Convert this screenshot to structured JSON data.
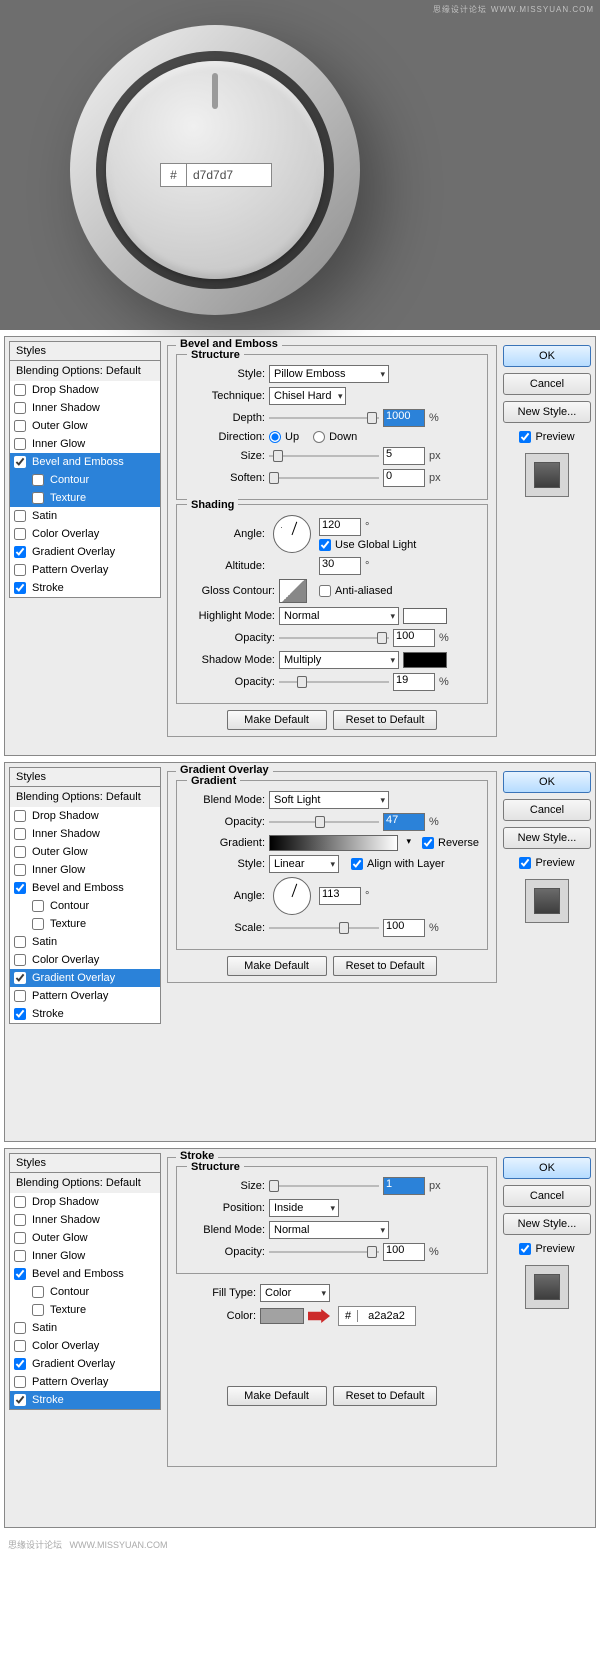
{
  "watermark": {
    "cn": "思缘设计论坛",
    "url": "WWW.MISSYUAN.COM"
  },
  "knob": {
    "hash": "#",
    "hex": "d7d7d7"
  },
  "styles": {
    "header": "Styles",
    "blending": "Blending Options: Default",
    "items": [
      {
        "label": "Drop Shadow",
        "checked": false,
        "indent": false
      },
      {
        "label": "Inner Shadow",
        "checked": false,
        "indent": false
      },
      {
        "label": "Outer Glow",
        "checked": false,
        "indent": false
      },
      {
        "label": "Inner Glow",
        "checked": false,
        "indent": false
      },
      {
        "label": "Bevel and Emboss",
        "checked": true,
        "indent": false
      },
      {
        "label": "Contour",
        "checked": false,
        "indent": true
      },
      {
        "label": "Texture",
        "checked": false,
        "indent": true
      },
      {
        "label": "Satin",
        "checked": false,
        "indent": false
      },
      {
        "label": "Color Overlay",
        "checked": false,
        "indent": false
      },
      {
        "label": "Gradient Overlay",
        "checked": true,
        "indent": false
      },
      {
        "label": "Pattern Overlay",
        "checked": false,
        "indent": false
      },
      {
        "label": "Stroke",
        "checked": true,
        "indent": false
      }
    ]
  },
  "panel1": {
    "selected": "Bevel and Emboss",
    "title": "Bevel and Emboss",
    "structure": {
      "legend": "Structure",
      "style_lbl": "Style:",
      "style_val": "Pillow Emboss",
      "tech_lbl": "Technique:",
      "tech_val": "Chisel Hard",
      "depth_lbl": "Depth:",
      "depth_val": "1000",
      "depth_unit": "%",
      "dir_lbl": "Direction:",
      "up": "Up",
      "down": "Down",
      "size_lbl": "Size:",
      "size_val": "5",
      "size_unit": "px",
      "soften_lbl": "Soften:",
      "soften_val": "0",
      "soften_unit": "px"
    },
    "shading": {
      "legend": "Shading",
      "angle_lbl": "Angle:",
      "angle_val": "120",
      "angle_unit": "°",
      "global": "Use Global Light",
      "alt_lbl": "Altitude:",
      "alt_val": "30",
      "alt_unit": "°",
      "gloss_lbl": "Gloss Contour:",
      "anti": "Anti-aliased",
      "hlmode_lbl": "Highlight Mode:",
      "hlmode_val": "Normal",
      "hlop_lbl": "Opacity:",
      "hlop_val": "100",
      "hlop_unit": "%",
      "shmode_lbl": "Shadow Mode:",
      "shmode_val": "Multiply",
      "shop_lbl": "Opacity:",
      "shop_val": "19",
      "shop_unit": "%"
    }
  },
  "panel2": {
    "selected": "Gradient Overlay",
    "title": "Gradient Overlay",
    "legend": "Gradient",
    "blend_lbl": "Blend Mode:",
    "blend_val": "Soft Light",
    "op_lbl": "Opacity:",
    "op_val": "47",
    "op_unit": "%",
    "grad_lbl": "Gradient:",
    "reverse": "Reverse",
    "style_lbl": "Style:",
    "style_val": "Linear",
    "align": "Align with Layer",
    "angle_lbl": "Angle:",
    "angle_val": "113",
    "angle_unit": "°",
    "scale_lbl": "Scale:",
    "scale_val": "100",
    "scale_unit": "%"
  },
  "panel3": {
    "selected": "Stroke",
    "title": "Stroke",
    "legend": "Structure",
    "size_lbl": "Size:",
    "size_val": "1",
    "size_unit": "px",
    "pos_lbl": "Position:",
    "pos_val": "Inside",
    "blend_lbl": "Blend Mode:",
    "blend_val": "Normal",
    "op_lbl": "Opacity:",
    "op_val": "100",
    "op_unit": "%",
    "fill_lbl": "Fill Type:",
    "fill_val": "Color",
    "color_lbl": "Color:",
    "hash": "#",
    "hex": "a2a2a2"
  },
  "buttons": {
    "make_default": "Make Default",
    "reset_default": "Reset to Default",
    "ok": "OK",
    "cancel": "Cancel",
    "new_style": "New Style...",
    "preview": "Preview"
  }
}
